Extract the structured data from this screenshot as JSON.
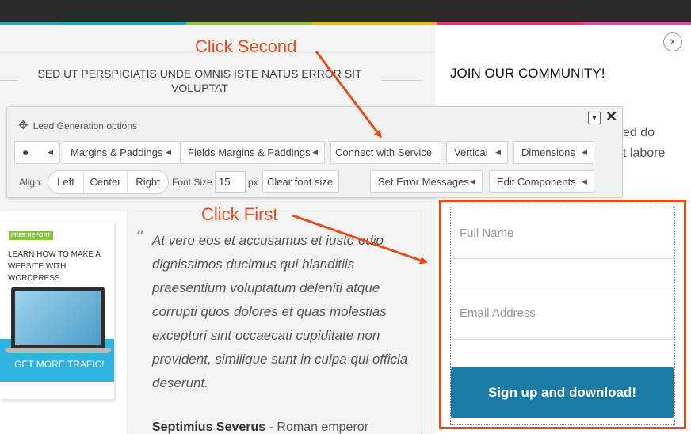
{
  "page": {
    "headline": "SED UT PERSPICIATIS UNDE OMNIS ISTE NATUS ERROR SIT VOLUPTAT",
    "close_label": "x",
    "join_title": "JOIN OUR COMMUNITY!",
    "body_fragment_1": "ed do",
    "body_fragment_2": "t labore"
  },
  "toolbar": {
    "title": "Lead Generation options",
    "move_icon": "move-icon",
    "minimize_icon": "minimize-icon",
    "close_icon": "close-icon",
    "row1": {
      "palette_icon": "palette-icon",
      "margins": "Margins & Paddings",
      "fields_margins": "Fields Margins & Paddings",
      "connect": "Connect with Service",
      "vertical": "Vertical",
      "dimensions": "Dimensions"
    },
    "row2": {
      "align_label": "Align:",
      "align_options": [
        "Left",
        "Center",
        "Right"
      ],
      "font_size_label": "Font Size",
      "font_size_value": "15",
      "font_size_unit": "px",
      "clear_font": "Clear font size",
      "error_messages": "Set Error Messages",
      "edit_components": "Edit Components"
    }
  },
  "ebook": {
    "badge": "FREE REPORT",
    "title": "LEARN HOW TO MAKE A WEBSITE WITH WORDPRESS",
    "cta": "GET MORE TRAFIC!"
  },
  "quote": {
    "mark": "“",
    "text": "At vero eos et accusamus et iusto odio dignissimos ducimus qui blanditiis praesentium voluptatum deleniti atque corrupti quos dolores et quas molestias excepturi sint occaecati cupiditate non provident, similique sunt in culpa qui officia deserunt.",
    "author_name": "Septimius Severus",
    "author_sep": " - ",
    "author_role": "Roman emperor"
  },
  "form": {
    "full_name_placeholder": "Full Name",
    "email_placeholder": "Email Address",
    "submit_label": "Sign up and download!"
  },
  "annotations": {
    "click_second": "Click Second",
    "click_first": "Click First",
    "color": "#e84c1c"
  },
  "colors": {
    "accent_stripes": [
      "#2aa5c5",
      "#1ea0d4",
      "#8cc63f",
      "#f6b21b",
      "#e9396f",
      "#d94fa0"
    ],
    "submit_button": "#1b7ba6",
    "ebook_cta": "#30b3e0"
  }
}
